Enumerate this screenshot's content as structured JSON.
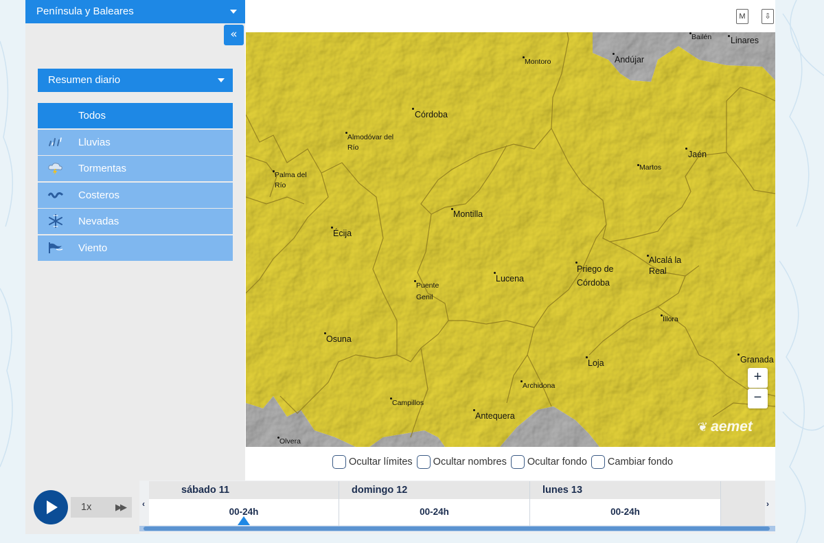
{
  "region": {
    "label": "Península y Baleares"
  },
  "sidebar": {
    "collapse_glyph": "«",
    "summary_label": "Resumen diario",
    "filters": [
      {
        "label": "Todos",
        "icon": "none",
        "active": true
      },
      {
        "label": "Lluvias",
        "icon": "rain-icon"
      },
      {
        "label": "Tormentas",
        "icon": "storm-icon"
      },
      {
        "label": "Costeros",
        "icon": "coastal-waves-icon"
      },
      {
        "label": "Nevadas",
        "icon": "snowflake-icon"
      },
      {
        "label": "Viento",
        "icon": "wind-icon"
      }
    ]
  },
  "toolbar": {
    "map_button_label": "M",
    "download_button_label": "⇩"
  },
  "map": {
    "cities": [
      {
        "name": "Bailén"
      },
      {
        "name": "Linares"
      },
      {
        "name": "Montoro"
      },
      {
        "name": "Andújar"
      },
      {
        "name": "Córdoba"
      },
      {
        "name": "Almodóvar del Río"
      },
      {
        "name": "Jaén"
      },
      {
        "name": "Martos"
      },
      {
        "name": "Palma del Río"
      },
      {
        "name": "Montilla"
      },
      {
        "name": "Écija"
      },
      {
        "name": "Alcalá la Real"
      },
      {
        "name": "Priego de Córdoba"
      },
      {
        "name": "Lucena"
      },
      {
        "name": "Puente Genil"
      },
      {
        "name": "Íllora"
      },
      {
        "name": "Osuna"
      },
      {
        "name": "Granada"
      },
      {
        "name": "Loja"
      },
      {
        "name": "Archidona"
      },
      {
        "name": "Campillos"
      },
      {
        "name": "Antequera"
      },
      {
        "name": "Olvera"
      }
    ],
    "zoom_in_label": "+",
    "zoom_out_label": "−",
    "logo_text": "aemet",
    "colors": {
      "warning_yellow": "#e6d43a",
      "no_warning_grey": "#b4b4b4",
      "boundary": "#8d7a1e"
    }
  },
  "map_options": [
    {
      "label": "Ocultar límites"
    },
    {
      "label": "Ocultar nombres"
    },
    {
      "label": "Ocultar fondo"
    },
    {
      "label": "Cambiar fondo"
    }
  ],
  "player": {
    "speed": "1x",
    "prev_glyph": "‹",
    "next_glyph": "›"
  },
  "timeline": {
    "days": [
      {
        "day": "sábado 11",
        "slot": "00-24h",
        "selected": true
      },
      {
        "day": "domingo 12",
        "slot": "00-24h"
      },
      {
        "day": "lunes 13",
        "slot": "00-24h"
      }
    ]
  },
  "colors": {
    "primary": "#1e88e5",
    "primary_light": "#7fb7ef",
    "dark_blue": "#0b4d96"
  }
}
